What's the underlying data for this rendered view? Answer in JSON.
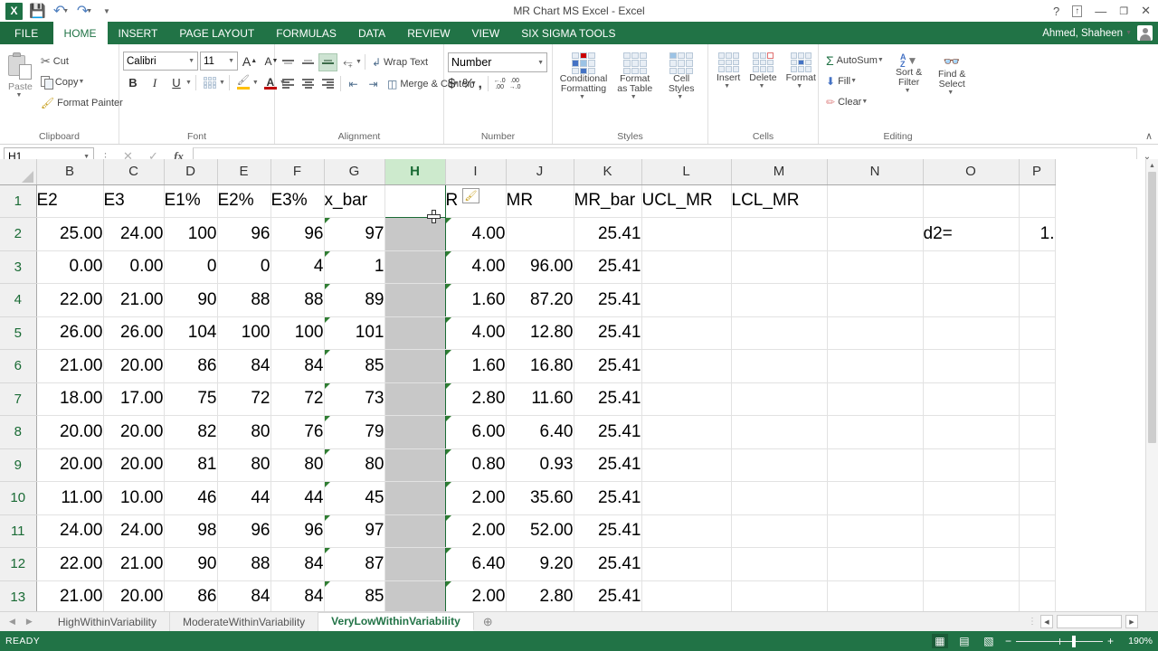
{
  "window": {
    "title": "MR Chart MS Excel - Excel",
    "user": "Ahmed, Shaheen",
    "help": "?",
    "ribbon_display": "↑",
    "minimize": "—",
    "restore": "❐",
    "close": "✕"
  },
  "quick_access": {
    "save": "💾",
    "undo": "↶",
    "redo": "↷",
    "customize": "≡",
    "logo": "X"
  },
  "ribbon_tabs": [
    {
      "label": "FILE",
      "active": false
    },
    {
      "label": "HOME",
      "active": true
    },
    {
      "label": "INSERT",
      "active": false
    },
    {
      "label": "PAGE LAYOUT",
      "active": false
    },
    {
      "label": "FORMULAS",
      "active": false
    },
    {
      "label": "DATA",
      "active": false
    },
    {
      "label": "REVIEW",
      "active": false
    },
    {
      "label": "VIEW",
      "active": false
    },
    {
      "label": "SIX SIGMA TOOLS",
      "active": false
    }
  ],
  "ribbon": {
    "clipboard": {
      "label": "Clipboard",
      "paste": "Paste",
      "cut": "Cut",
      "copy": "Copy",
      "format_painter": "Format Painter"
    },
    "font": {
      "label": "Font",
      "font_name": "Calibri",
      "font_size": "11",
      "grow": "A",
      "shrink": "A",
      "bold": "B",
      "italic": "I",
      "underline": "U"
    },
    "alignment": {
      "label": "Alignment",
      "wrap_text": "Wrap Text",
      "merge_center": "Merge & Center"
    },
    "number": {
      "label": "Number",
      "format": "Number",
      "currency": "$",
      "percent": "%",
      "comma": ",",
      "increase_decimal": ".00",
      "decrease_decimal": ".00"
    },
    "styles": {
      "label": "Styles",
      "conditional_formatting": "Conditional Formatting",
      "format_as_table": "Format as Table",
      "cell_styles": "Cell Styles"
    },
    "cells": {
      "label": "Cells",
      "insert": "Insert",
      "delete": "Delete",
      "format": "Format"
    },
    "editing": {
      "label": "Editing",
      "autosum": "AutoSum",
      "fill": "Fill",
      "clear": "Clear",
      "sort_filter": "Sort & Filter",
      "find_select": "Find & Select"
    },
    "collapse": "∧"
  },
  "formula_bar": {
    "name_box": "H1",
    "cancel": "✕",
    "enter": "✓",
    "insert_function": "fx",
    "value": "",
    "expand": "⌄"
  },
  "grid": {
    "columns": [
      "B",
      "C",
      "D",
      "E",
      "F",
      "G",
      "H",
      "I",
      "J",
      "K",
      "L",
      "M",
      "N",
      "O",
      "P"
    ],
    "selected_column": "H",
    "active_cell": "H1",
    "rows": [
      "1",
      "2",
      "3",
      "4",
      "5",
      "6",
      "7",
      "8",
      "9",
      "10",
      "11",
      "12",
      "13"
    ],
    "data": [
      [
        "E2",
        "E3",
        "E1%",
        "E2%",
        "E3%",
        "x_bar",
        "",
        "R",
        "MR",
        "MR_bar",
        "UCL_MR",
        "LCL_MR",
        "",
        "",
        ""
      ],
      [
        "25.00",
        "24.00",
        "100",
        "96",
        "96",
        "97",
        "",
        "4.00",
        "",
        "25.41",
        "",
        "",
        "",
        "d2=",
        "1."
      ],
      [
        "0.00",
        "0.00",
        "0",
        "0",
        "4",
        "1",
        "",
        "4.00",
        "96.00",
        "25.41",
        "",
        "",
        "",
        "",
        ""
      ],
      [
        "22.00",
        "21.00",
        "90",
        "88",
        "88",
        "89",
        "",
        "1.60",
        "87.20",
        "25.41",
        "",
        "",
        "",
        "",
        ""
      ],
      [
        "26.00",
        "26.00",
        "104",
        "100",
        "100",
        "101",
        "",
        "4.00",
        "12.80",
        "25.41",
        "",
        "",
        "",
        "",
        ""
      ],
      [
        "21.00",
        "20.00",
        "86",
        "84",
        "84",
        "85",
        "",
        "1.60",
        "16.80",
        "25.41",
        "",
        "",
        "",
        "",
        ""
      ],
      [
        "18.00",
        "17.00",
        "75",
        "72",
        "72",
        "73",
        "",
        "2.80",
        "11.60",
        "25.41",
        "",
        "",
        "",
        "",
        ""
      ],
      [
        "20.00",
        "20.00",
        "82",
        "80",
        "76",
        "79",
        "",
        "6.00",
        "6.40",
        "25.41",
        "",
        "",
        "",
        "",
        ""
      ],
      [
        "20.00",
        "20.00",
        "81",
        "80",
        "80",
        "80",
        "",
        "0.80",
        "0.93",
        "25.41",
        "",
        "",
        "",
        "",
        ""
      ],
      [
        "11.00",
        "10.00",
        "46",
        "44",
        "44",
        "45",
        "",
        "2.00",
        "35.60",
        "25.41",
        "",
        "",
        "",
        "",
        ""
      ],
      [
        "24.00",
        "24.00",
        "98",
        "96",
        "96",
        "97",
        "",
        "2.00",
        "52.00",
        "25.41",
        "",
        "",
        "",
        "",
        ""
      ],
      [
        "22.00",
        "21.00",
        "90",
        "88",
        "84",
        "87",
        "",
        "6.40",
        "9.20",
        "25.41",
        "",
        "",
        "",
        "",
        ""
      ],
      [
        "21.00",
        "20.00",
        "86",
        "84",
        "84",
        "85",
        "",
        "2.00",
        "2.80",
        "25.41",
        "",
        "",
        "",
        "",
        ""
      ]
    ]
  },
  "sheet_tabs": {
    "prev": "◀",
    "next": "▶",
    "tabs": [
      {
        "label": "HighWithinVariability",
        "active": false
      },
      {
        "label": "ModerateWithinVariability",
        "active": false
      },
      {
        "label": "VeryLowWithinVariability",
        "active": true
      }
    ],
    "add": "⊕"
  },
  "status_bar": {
    "state": "READY",
    "view_normal": "▦",
    "view_layout": "▤",
    "view_pagebreak": "▧",
    "zoom_out": "−",
    "zoom_in": "+",
    "zoom_level": "190%"
  },
  "colors": {
    "excel_green": "#217346",
    "tab_green": "#1e6b3f",
    "selection_green": "#1a6b35",
    "header_select": "#cdeacd",
    "col_selected_fill": "#c8c8c8"
  }
}
